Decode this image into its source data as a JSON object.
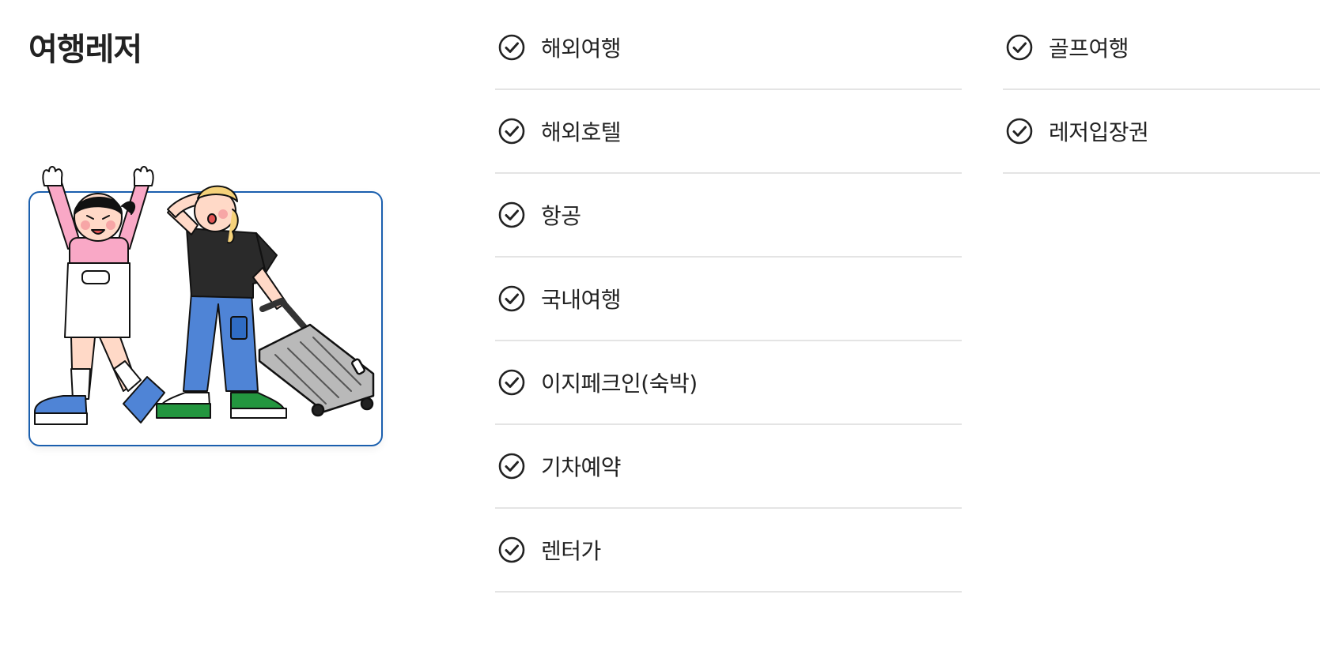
{
  "section": {
    "title": "여행레저"
  },
  "menu": {
    "column_1": [
      {
        "label": "해외여행"
      },
      {
        "label": "해외호텔"
      },
      {
        "label": "항공"
      },
      {
        "label": "국내여행"
      },
      {
        "label": "이지페크인(숙박)"
      },
      {
        "label": "기차예약"
      },
      {
        "label": "렌터가"
      }
    ],
    "column_2": [
      {
        "label": "골프여행"
      },
      {
        "label": "레저입장권"
      }
    ]
  },
  "icons": {
    "menu_item_icon": "check-circle-icon"
  },
  "colors": {
    "frame_border": "#1a5fae",
    "text": "#222222",
    "divider": "#e4e4e4"
  }
}
